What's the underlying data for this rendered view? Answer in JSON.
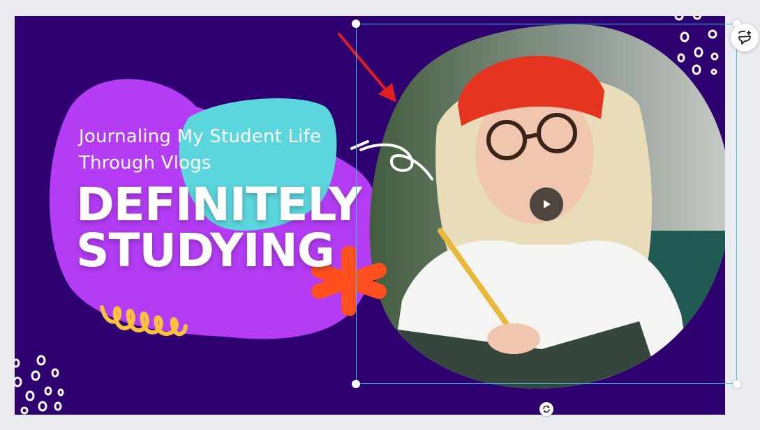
{
  "design": {
    "subtitle_line1": "Journaling My Student Life",
    "subtitle_line2": "Through Vlogs",
    "title_line1": "DEFINITELY",
    "title_line2": "STUDYING"
  },
  "colors": {
    "background": "#2e0070",
    "purple_blob": "#b43cf5",
    "teal_blob": "#5bd6dd",
    "orange_asterisk": "#ff4f1f",
    "yellow_squiggle": "#f9c23c",
    "selection": "#35c4f0",
    "arrow": "#e02020"
  },
  "icons": {
    "play": "play-icon",
    "comment": "add-comment-icon",
    "rotate": "rotate-icon"
  }
}
